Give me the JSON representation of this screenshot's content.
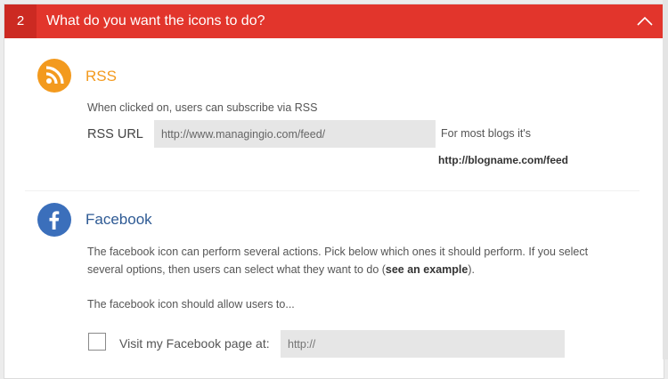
{
  "header": {
    "number": "2",
    "title": "What do you want the icons to do?",
    "chevron_icon": "chevron-up-icon"
  },
  "rss": {
    "icon": "rss-icon",
    "color": "#f39a1e",
    "title": "RSS",
    "description": "When clicked on, users can subscribe via RSS",
    "url_label": "RSS URL",
    "url_value": "http://www.managingio.com/feed/",
    "hint": "For most blogs it's",
    "hint_url": "http://blogname.com/feed"
  },
  "facebook": {
    "icon": "facebook-icon",
    "color": "#3b6fbb",
    "title": "Facebook",
    "description_line1": "The facebook icon can perform several actions. Pick below which ones it should perform. If you select",
    "description_line2_prefix": "several options, then users can select what they want to do (",
    "description_link": "see an example",
    "description_line2_suffix": ").",
    "allow_text": "The facebook icon should allow users to...",
    "visit_label": "Visit my Facebook page at:",
    "visit_placeholder": "http://",
    "visit_checked": false
  },
  "colors": {
    "header_bg": "#e2352c",
    "header_num_bg": "#cc2a22"
  }
}
